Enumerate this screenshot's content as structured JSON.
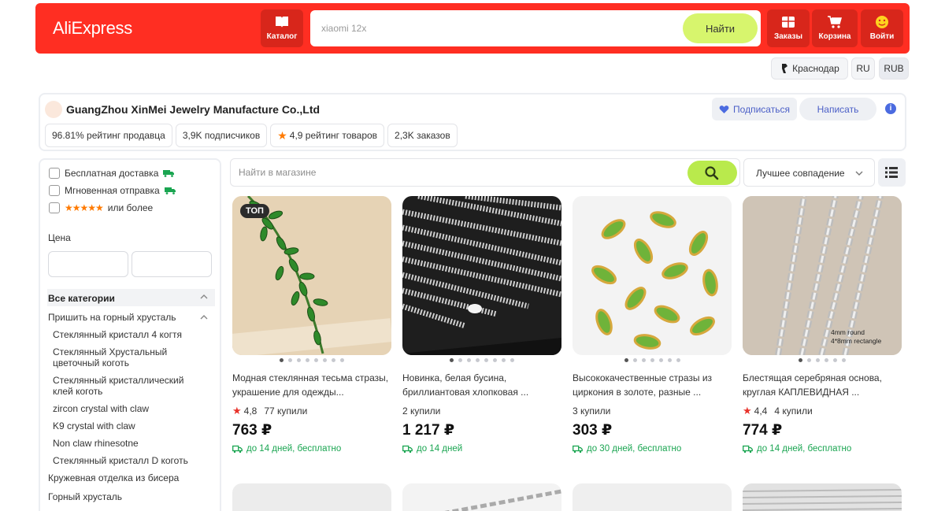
{
  "header": {
    "logo": "AliExpress",
    "catalog_label": "Каталог",
    "search_placeholder": "xiaomi 12x",
    "search_button": "Найти",
    "orders_label": "Заказы",
    "cart_label": "Корзина",
    "login_label": "Войти"
  },
  "locale": {
    "city": "Краснодар",
    "language": "RU",
    "currency": "RUB"
  },
  "store": {
    "name": "GuangZhou XinMei Jewelry Manufacture Co.,Ltd",
    "stats": {
      "seller_rating": "96.81% рейтинг продавца",
      "subscribers": "3,9K подписчиков",
      "product_rating": "4,9 рейтинг товаров",
      "orders": "2,3K заказов"
    },
    "subscribe_label": "Подписаться",
    "message_label": "Написать"
  },
  "filters": {
    "free_delivery": "Бесплатная доставка",
    "instant_dispatch": "Мгновенная отправка",
    "rating_suffix": "или более",
    "price_label": "Цена",
    "all_categories": "Все категории",
    "categories": [
      "Пришить на горный хрусталь",
      "Стеклянный кристалл 4 когтя",
      "Стеклянный Хрустальный цветочный коготь",
      "Стеклянный кристаллический клей коготь",
      "zircon crystal with claw",
      "K9 crystal with claw",
      "Non claw rhinesotne",
      "Стеклянный кристалл D коготь",
      "Кружевная отделка из бисера",
      "Горный хрусталь"
    ]
  },
  "shop_search": {
    "placeholder": "Найти в магазине",
    "sort": "Лучшее совпадение"
  },
  "products": [
    {
      "badge": "ТОП",
      "title": "Модная стеклянная тесьма стразы, украшение для одежды...",
      "rating": "4,8",
      "sold": "77 купили",
      "price": "763 ₽",
      "delivery": "до 14 дней, бесплатно"
    },
    {
      "title": "Новинка, белая бусина, бриллиантовая хлопковая ...",
      "sold": "2 купили",
      "price": "1 217 ₽",
      "delivery": "до 14 дней"
    },
    {
      "title": "Высококачественные стразы из циркония в золоте, разные ...",
      "sold": "3 купили",
      "price": "303 ₽",
      "delivery": "до 30 дней, бесплатно"
    },
    {
      "title": "Блестящая серебряная основа, круглая КАПЛЕВИДНАЯ ...",
      "rating": "4,4",
      "sold": "4 купили",
      "price": "774 ₽",
      "delivery": "до 14 дней, бесплатно",
      "image_text_1": "4mm round",
      "image_text_2": "4*8mm rectangle"
    }
  ],
  "colors": {
    "brand_red": "#ff2e22",
    "accent_green": "#d7f56d",
    "delivery_green": "#1aa551",
    "star_orange": "#ff7a00"
  }
}
